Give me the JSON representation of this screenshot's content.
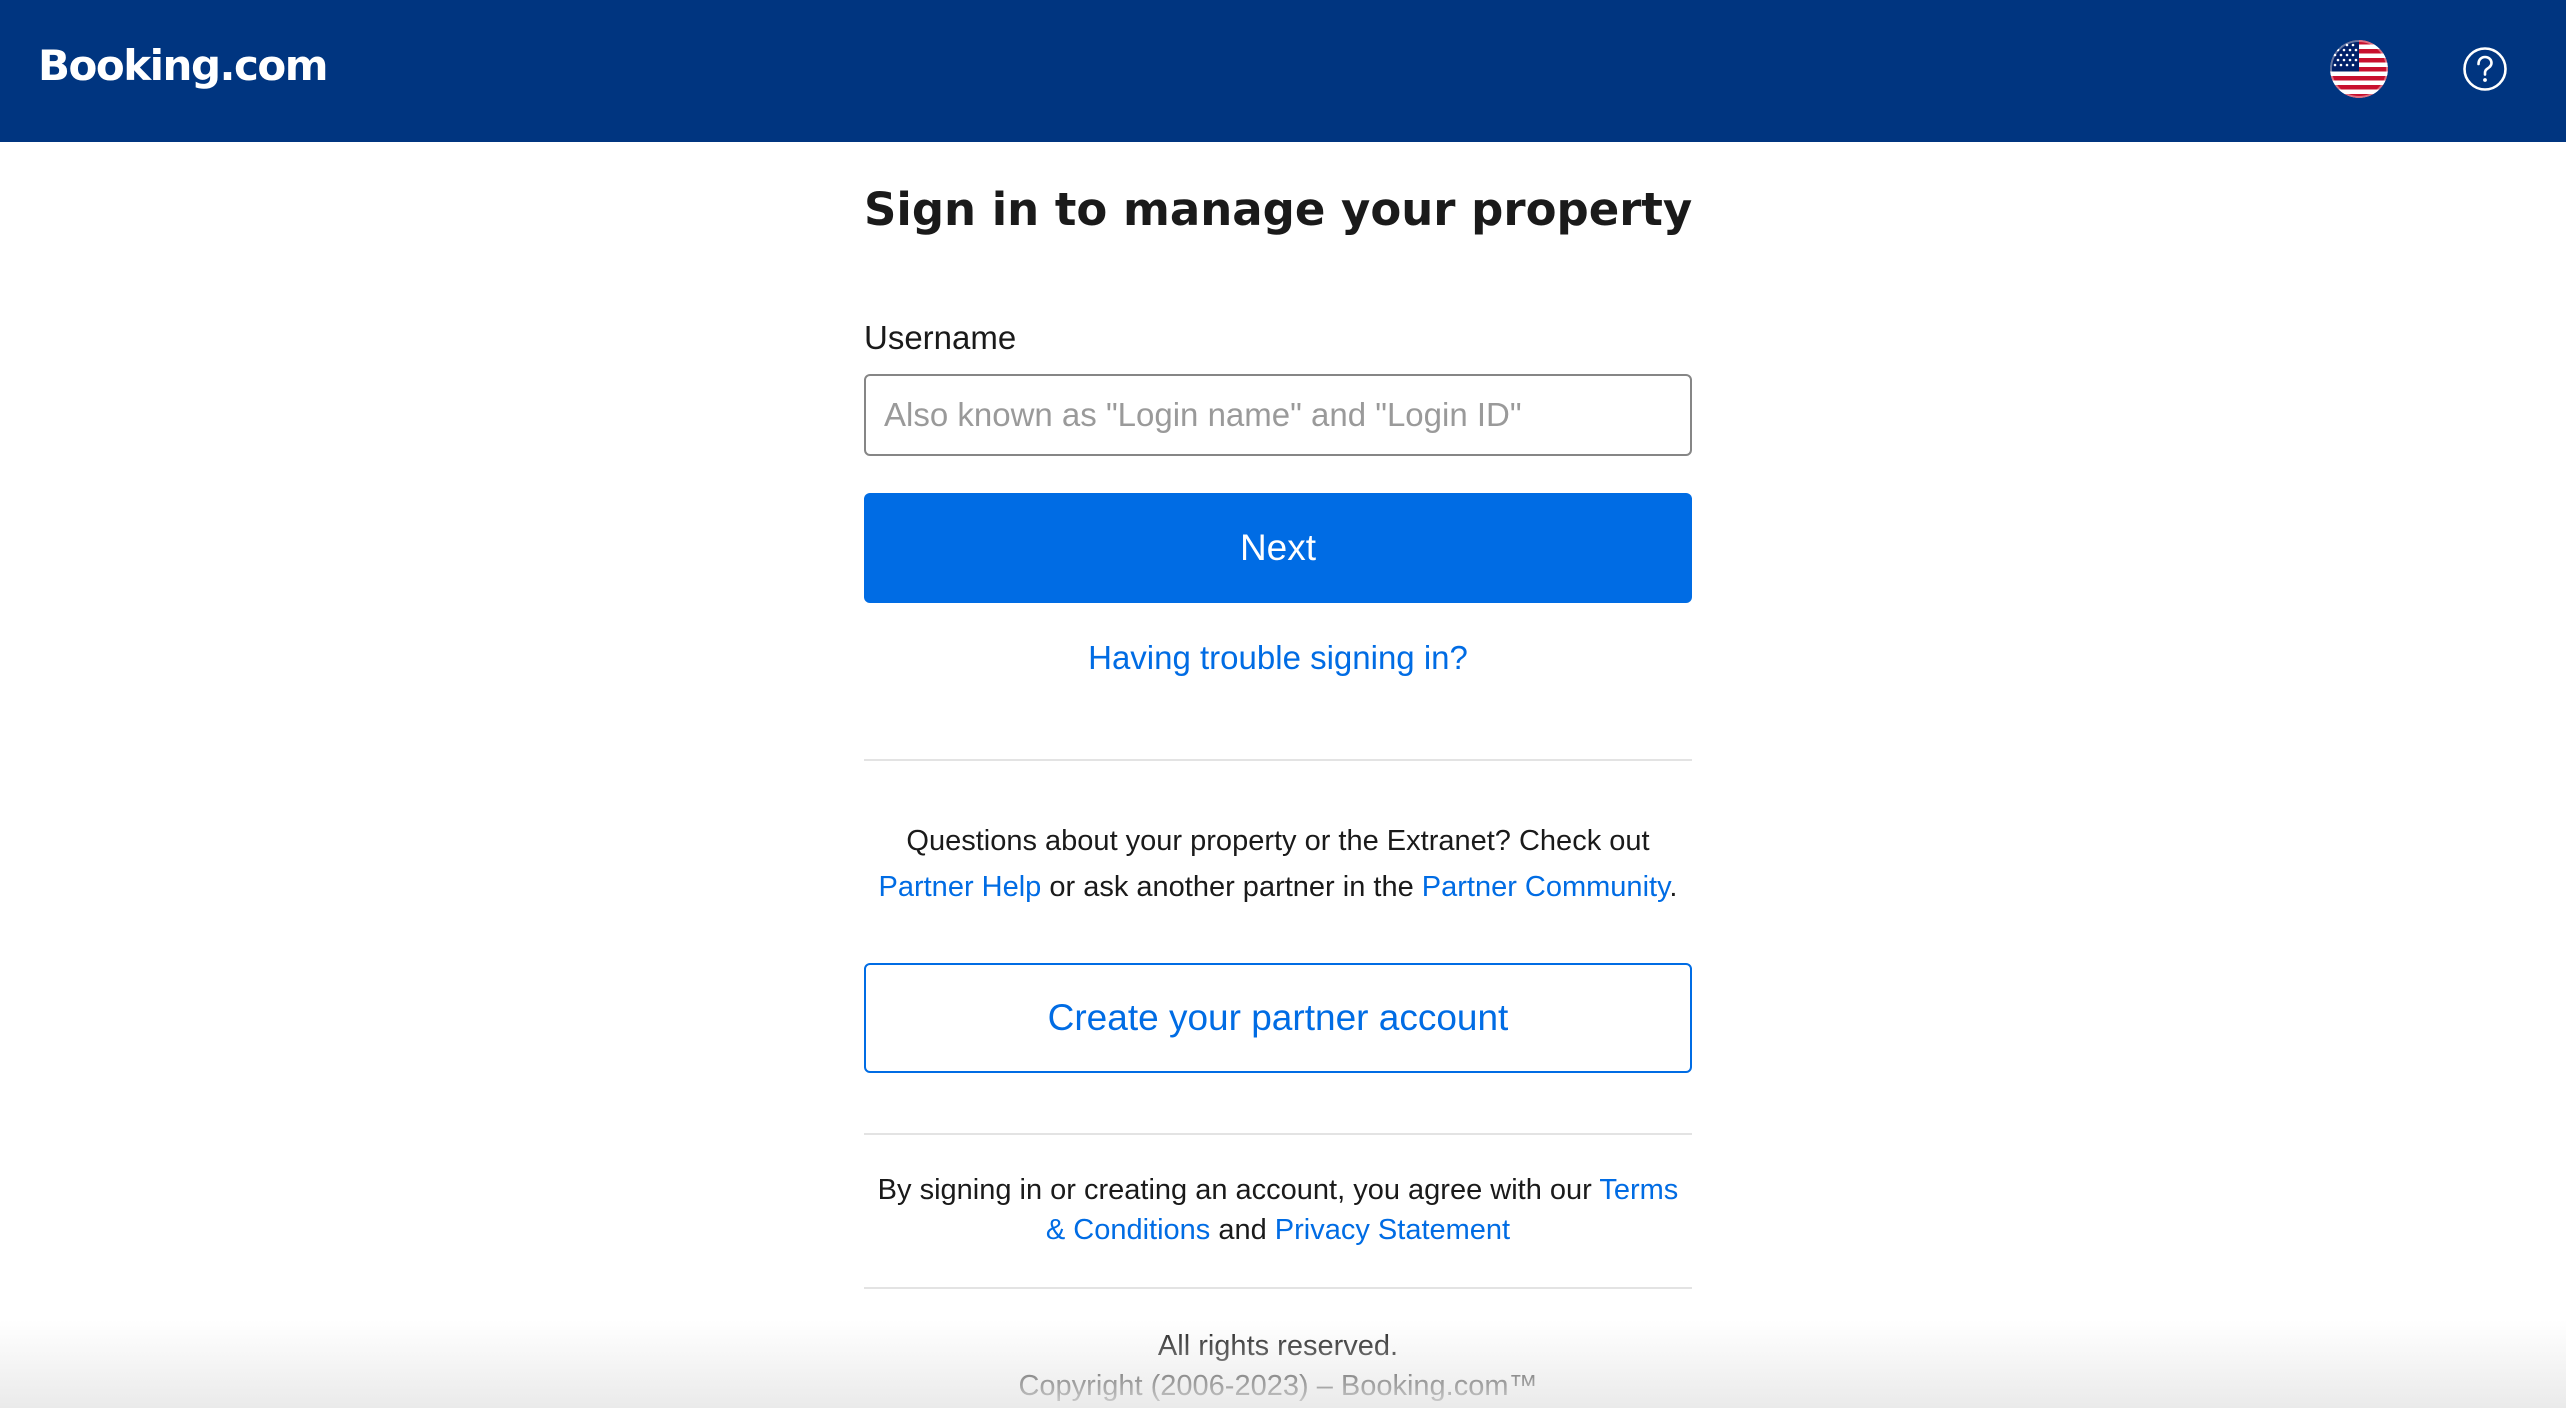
{
  "header": {
    "logo_text": "Booking.com",
    "language_icon": "us-flag-icon",
    "help_icon": "question-circle-icon",
    "background_color": "#003580"
  },
  "main": {
    "title": "Sign in to manage your property",
    "username_label": "Username",
    "username_placeholder": "Also known as \"Login name\" and \"Login ID\"",
    "username_value": "",
    "next_label": "Next",
    "trouble_link": "Having trouble signing in?",
    "help_text_1": "Questions about your property or the Extranet? Check out",
    "partner_help_link": "Partner Help",
    "help_text_2": " or ask another partner in the ",
    "partner_community_link": "Partner Community",
    "help_text_3": ".",
    "create_account_label": "Create your partner account",
    "legal_text_1": "By signing in or creating an account, you agree with our ",
    "terms_link": "Terms & Conditions",
    "legal_text_2": " and ",
    "privacy_link": "Privacy Statement"
  },
  "footer": {
    "rights": "All rights reserved.",
    "copyright": "Copyright (2006-2023) – Booking.com™"
  },
  "colors": {
    "brand_blue": "#003580",
    "action_blue": "#006ce4",
    "text": "#1a1a1a",
    "divider": "#e3e3e3"
  }
}
